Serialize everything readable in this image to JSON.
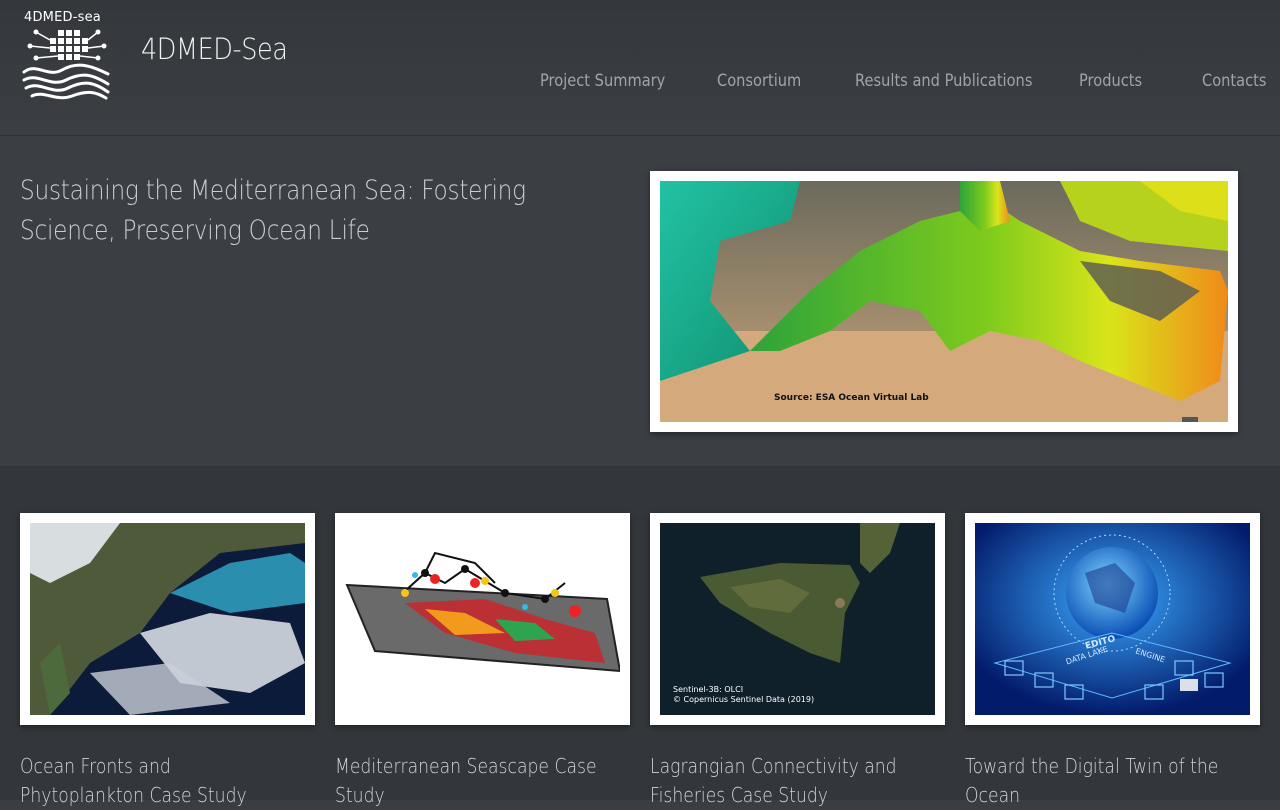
{
  "brand": {
    "logo_text": "4DMED-sea",
    "site_title": "4DMED-Sea"
  },
  "nav": {
    "items": [
      {
        "label": "Project Summary"
      },
      {
        "label": "Consortium"
      },
      {
        "label": "Results and Publications"
      },
      {
        "label": "Products"
      },
      {
        "label": "Contacts"
      }
    ]
  },
  "hero": {
    "title": "Sustaining the Mediterranean Sea: Fostering Science, Preserving Ocean Life",
    "image_caption": "Source: ESA Ocean Virtual Lab"
  },
  "cards": [
    {
      "title": "Ocean Fronts and Phytoplankton Case Study"
    },
    {
      "title": "Mediterranean Seascape Case Study"
    },
    {
      "title": "Lagrangian Connectivity and Fisheries Case Study",
      "caption_line1": "Sentinel-3B: OLCI",
      "caption_line2": "© Copernicus Sentinel Data (2019)"
    },
    {
      "title": "Toward the Digital Twin of the Ocean",
      "graphic_labels": [
        "EDITO",
        "DATA LAKE",
        "ENGINE"
      ]
    }
  ],
  "colors": {
    "background": "#3a3e43",
    "nav_text": "#9ea4aa",
    "title_text": "#f0f2f4"
  }
}
